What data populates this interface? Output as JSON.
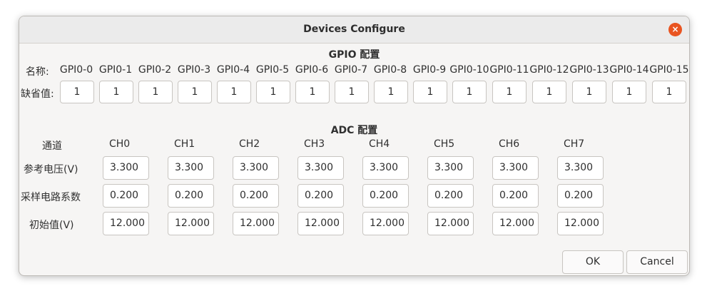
{
  "window": {
    "title": "Devices Configure",
    "close_icon": "×"
  },
  "gpio": {
    "section_title": "GPIO 配置",
    "name_label": "名称:",
    "default_label": "缺省值:",
    "names": [
      "GPI0-0",
      "GPI0-1",
      "GPI0-2",
      "GPI0-3",
      "GPI0-4",
      "GPI0-5",
      "GPI0-6",
      "GPI0-7",
      "GPI0-8",
      "GPI0-9",
      "GPI0-10",
      "GPI0-11",
      "GPI0-12",
      "GPI0-13",
      "GPI0-14",
      "GPI0-15"
    ],
    "defaults": [
      "1",
      "1",
      "1",
      "1",
      "1",
      "1",
      "1",
      "1",
      "1",
      "1",
      "1",
      "1",
      "1",
      "1",
      "1",
      "1"
    ]
  },
  "adc": {
    "section_title": "ADC 配置",
    "channel_label": "通道",
    "channels": [
      "CH0",
      "CH1",
      "CH2",
      "CH3",
      "CH4",
      "CH5",
      "CH6",
      "CH7"
    ],
    "rows": [
      {
        "label": "参考电压(V)",
        "values": [
          "3.300",
          "3.300",
          "3.300",
          "3.300",
          "3.300",
          "3.300",
          "3.300",
          "3.300"
        ]
      },
      {
        "label": "采样电路系数",
        "values": [
          "0.200",
          "0.200",
          "0.200",
          "0.200",
          "0.200",
          "0.200",
          "0.200",
          "0.200"
        ]
      },
      {
        "label": "初始值(V)",
        "values": [
          "12.000",
          "12.000",
          "12.000",
          "12.000",
          "12.000",
          "12.000",
          "12.000",
          "12.000"
        ]
      }
    ]
  },
  "buttons": {
    "ok": "OK",
    "cancel": "Cancel"
  },
  "colors": {
    "close_button": "#e95420"
  }
}
